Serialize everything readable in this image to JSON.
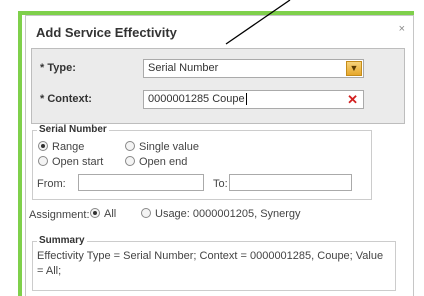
{
  "dialog": {
    "title": "Add Service Effectivity",
    "close_label": "×"
  },
  "type": {
    "label": "* Type:",
    "value": "Serial Number"
  },
  "context": {
    "label": "* Context:",
    "value": "0000001285 Coupe"
  },
  "serial_number": {
    "legend": "Serial Number",
    "options": [
      "Range",
      "Single value",
      "Open start",
      "Open end"
    ],
    "selected": "Range",
    "from_label": "From:",
    "to_label": "To:",
    "from_value": "",
    "to_value": ""
  },
  "assignment": {
    "label": "Assignment:",
    "options": [
      "All",
      "Usage: 0000001205, Synergy"
    ],
    "selected": "All"
  },
  "summary": {
    "legend": "Summary",
    "text": "Effectivity Type = Serial Number; Context = 0000001285, Coupe; Value = All;"
  },
  "colors": {
    "highlight": "#7fd04b",
    "dropdown_button": "#e6a72c",
    "clear_icon": "#d21f1f"
  },
  "icons": {
    "dropdown": "chevron-down-icon",
    "clear": "close-icon",
    "dialog_close": "close-icon"
  }
}
